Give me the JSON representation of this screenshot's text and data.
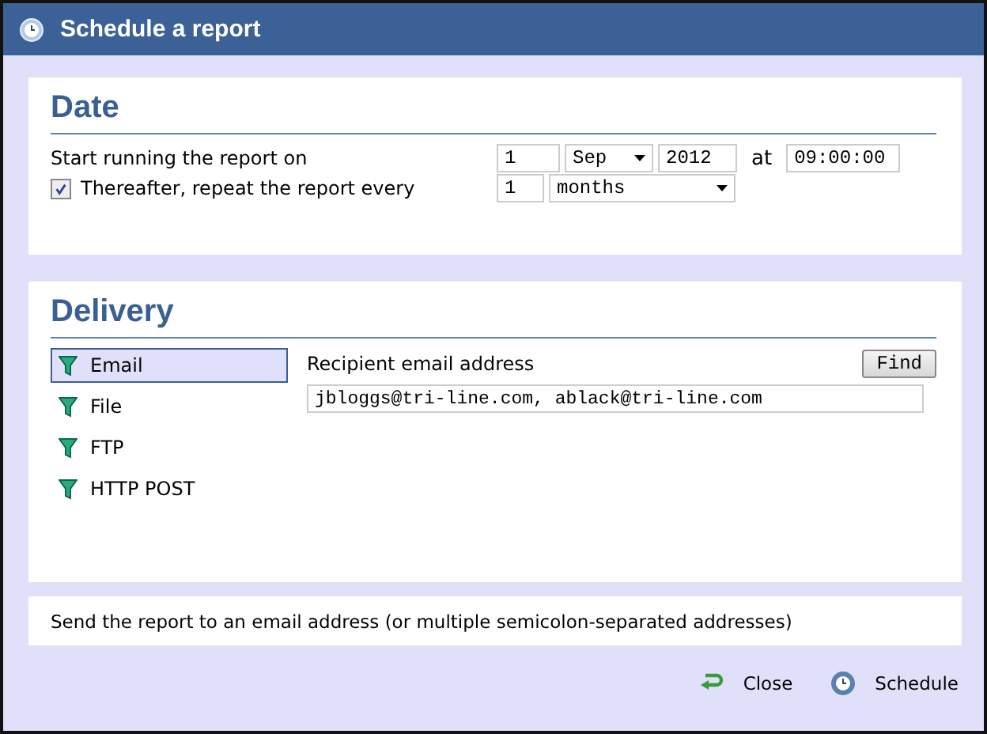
{
  "window": {
    "title": "Schedule a report"
  },
  "date": {
    "heading": "Date",
    "start_label": "Start running the report on",
    "day": "1",
    "month": "Sep",
    "year": "2012",
    "at_label": "at",
    "time": "09:00:00",
    "repeat": {
      "label": "Thereafter, repeat the report every",
      "checked": true,
      "count": "1",
      "unit": "months"
    }
  },
  "delivery": {
    "heading": "Delivery",
    "methods": [
      {
        "label": "Email",
        "selected": true
      },
      {
        "label": "File",
        "selected": false
      },
      {
        "label": "FTP",
        "selected": false
      },
      {
        "label": "HTTP POST",
        "selected": false
      }
    ],
    "recipient_label": "Recipient email address",
    "find_button": "Find",
    "recipients": "jbloggs@tri-line.com, ablack@tri-line.com"
  },
  "hint": "Send the report to an email address (or multiple semicolon-separated addresses)",
  "buttons": [
    {
      "kind": "close",
      "label": "Close"
    },
    {
      "kind": "schedule",
      "label": "Schedule"
    }
  ]
}
